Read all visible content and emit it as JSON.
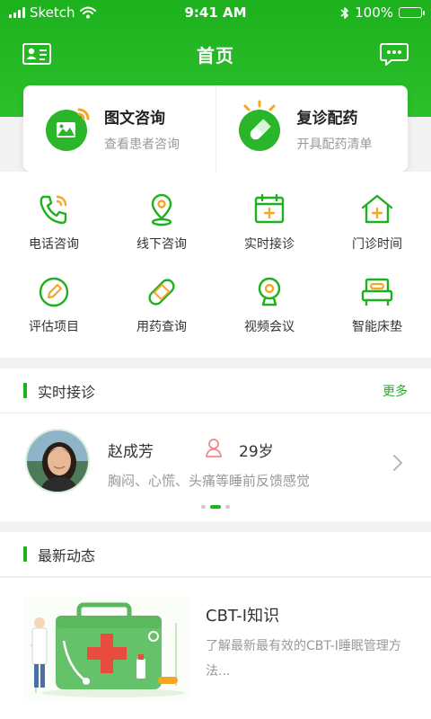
{
  "status_bar": {
    "carrier": "Sketch",
    "time": "9:41 AM",
    "battery": "100%"
  },
  "header": {
    "title": "首页",
    "left_icon": "id-card-icon",
    "right_icon": "message-icon"
  },
  "top_cards": [
    {
      "title": "图文咨询",
      "subtitle": "查看患者咨询",
      "icon": "image-consult-icon"
    },
    {
      "title": "复诊配药",
      "subtitle": "开具配药清单",
      "icon": "pill-icon"
    }
  ],
  "grid": [
    {
      "label": "电话咨询",
      "icon": "phone-icon"
    },
    {
      "label": "线下咨询",
      "icon": "location-pin-icon"
    },
    {
      "label": "实时接诊",
      "icon": "calendar-plus-icon"
    },
    {
      "label": "门诊时间",
      "icon": "clinic-house-icon"
    },
    {
      "label": "评估项目",
      "icon": "pencil-circle-icon"
    },
    {
      "label": "用药查询",
      "icon": "bandage-icon"
    },
    {
      "label": "视频会议",
      "icon": "webcam-icon"
    },
    {
      "label": "智能床垫",
      "icon": "bed-icon"
    }
  ],
  "realtime": {
    "title": "实时接诊",
    "more": "更多",
    "patient": {
      "name": "赵成芳",
      "age": "29岁",
      "symptom": "胸闷、心慌、头痛等睡前反馈感觉"
    }
  },
  "news": {
    "title": "最新动态",
    "item": {
      "title": "CBT-I知识",
      "desc": "了解最新最有效的CBT-I睡眠管理方法..."
    }
  },
  "colors": {
    "primary": "#1db21d",
    "accent": "#f5a623"
  }
}
